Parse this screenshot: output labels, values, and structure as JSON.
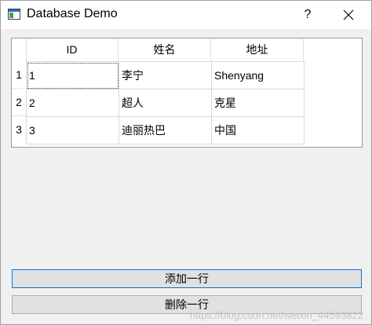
{
  "window": {
    "title": "Database Demo",
    "help_label": "?"
  },
  "table": {
    "headers": [
      "ID",
      "姓名",
      "地址"
    ],
    "row_labels": [
      "1",
      "2",
      "3"
    ],
    "rows": [
      [
        "1",
        "李宁",
        "Shenyang"
      ],
      [
        "2",
        "超人",
        "克星"
      ],
      [
        "3",
        "迪丽热巴",
        "中国"
      ]
    ]
  },
  "buttons": {
    "add_row": "添加一行",
    "delete_row": "删除一行"
  },
  "watermark": "https://blog.csdn.net/weixin_44593822",
  "colors": {
    "focus_border": "#0078d7",
    "button_bg": "#e1e1e1",
    "window_bg": "#f0f0f0"
  },
  "icons": {
    "app": "window-icon",
    "close": "close-icon"
  }
}
